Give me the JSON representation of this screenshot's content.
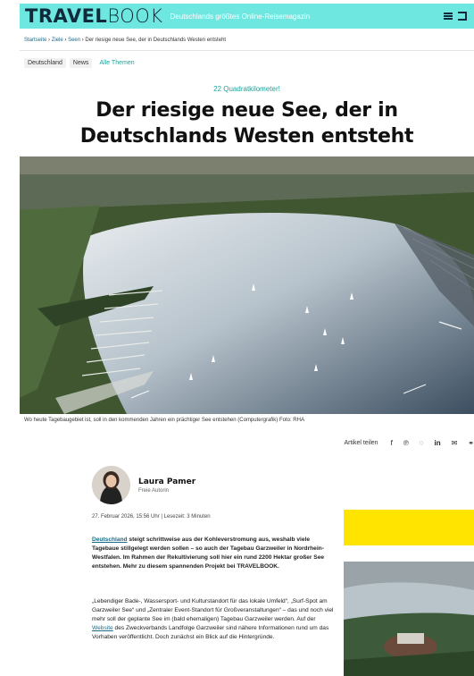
{
  "header": {
    "logo_bold": "TRAVEL",
    "logo_light": "BOOK",
    "tagline": "Deutschlands größtes Online-Reisemagazin"
  },
  "breadcrumb": {
    "items": [
      "Startseite",
      "Ziele",
      "Seen"
    ],
    "separator": "›",
    "current": "Der riesige neue See, der in Deutschlands Westen entsteht"
  },
  "tags": [
    "Deutschland",
    "News",
    "Alle Themen"
  ],
  "article": {
    "kicker": "22 Quadratkilometer!",
    "title": "Der riesige neue See, der in Deutschlands Westen entsteht",
    "caption": "Wo heute Tagebaugebiet ist, soll in den kommenden Jahren ein prächtiger See entstehen (Computergrafik) Foto: RHA",
    "share_label": "Artikel teilen",
    "author_name": "Laura Pamer",
    "author_role": "Freie Autorin",
    "meta": "27. Februar 2026, 15:56 Uhr | Lesezeit: 3 Minuten",
    "p1_link": "Deutschland",
    "p1_text": " steigt schrittweise aus der Kohleverstromung aus, weshalb viele Tagebaue stillgelegt werden sollen – so auch der Tagebau Garzweiler in Nordrhein-Westfalen. Im Rahmen der Rekultivierung soll hier ein rund 2200 Hektar großer See entstehen. Mehr zu diesem spannenden Projekt bei TRAVELBOOK.",
    "p2_before": "„Lebendiger Bade-, Wassersport- und Kulturstandort für das lokale Umfeld“, „Surf-Spot am Garzweiler See“ und „Zentraler Event-Standort für Großveranstaltungen“ – das und noch viel mehr soll der geplante See im (bald ehemaligen) Tagebau Garzweiler werden. Auf der ",
    "p2_link": "Website",
    "p2_after": " des Zweckverbands Landfolge Garzweiler sind nähere Informationen rund um das Vorhaben veröffentlicht. Doch zunächst ein Blick auf die Hintergründe."
  },
  "icons": [
    "menu-icon",
    "logout-icon",
    "facebook-icon",
    "pinterest-icon",
    "whatsapp-icon",
    "linkedin-icon",
    "mail-icon",
    "link-icon"
  ],
  "colors": {
    "header_bg": "#6ee7e0",
    "accent": "#1aa39a",
    "ad_yellow": "#ffe400",
    "link": "#1a6b8a"
  }
}
